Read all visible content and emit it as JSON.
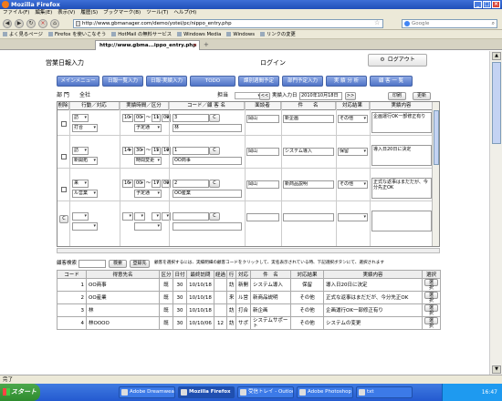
{
  "browser": {
    "title": "Mozilla Firefox",
    "menu": [
      "ファイル(F)",
      "編集(E)",
      "表示(V)",
      "履歴(S)",
      "ブックマーク(B)",
      "ツール(T)",
      "ヘルプ(H)"
    ],
    "url": "http://www.gbmanager.com/demo/yotei/pc/nippo_entry.php",
    "search_placeholder": "Google",
    "bookmarks": [
      "よく見るページ",
      "Firefox を使いこなそう",
      "HotMail の無料サービス",
      "Windows Media",
      "Windows",
      "リンクの変更"
    ],
    "tab_title": "http://www.gbma...ippo_entry.php",
    "status": "完了"
  },
  "header": {
    "system_title": "営業日報入力",
    "login_label": "ログイン",
    "logout_label": "ログアウト"
  },
  "nav": [
    "メインメニュー",
    "日報一覧入力",
    "日報-実績入力",
    "TODO",
    "課別週間予定",
    "部門予定入力",
    "実 績 分 析",
    "顧 客 一 覧"
  ],
  "filter": {
    "dept_label": "部 門",
    "dept_value": "全社",
    "person_label": "担当",
    "prev": "<<",
    "date_label": "実績入力日",
    "date_value": "2010年10月18日",
    "next": ">>",
    "print": "印刷",
    "update": "更新"
  },
  "form_headers": [
    "削除",
    "行動／対応",
    "実績時間／区分",
    "コード／顧 客 名",
    "面談者",
    "件　　名",
    "対応結果",
    "実績内容"
  ],
  "form_rows": [
    {
      "action1": "訪",
      "action2": "打合",
      "t1": "10",
      "m1": "00",
      "t2": "11",
      "m2": "00",
      "kubun": "予定通",
      "code": "3",
      "cust": "林",
      "person": "岡山",
      "subject": "新企画",
      "result": "その他",
      "content": "企画運行OK一部修正有り"
    },
    {
      "action1": "訪",
      "action2": "新開拓",
      "t1": "14",
      "m1": "30",
      "t2": "15",
      "m2": "10",
      "kubun": "時間変更",
      "code": "1",
      "cust": "OO商事",
      "person": "岡山",
      "subject": "システム導入",
      "result": "保留",
      "content": "導入日20日に決定"
    },
    {
      "action1": "来",
      "action2": "ル営業",
      "t1": "16",
      "m1": "00",
      "t2": "17",
      "m2": "00",
      "kubun": "予定通",
      "code": "2",
      "cust": "OO産業",
      "person": "岡山",
      "subject": "新商品説明",
      "result": "その他",
      "content": "正式な返事はまだだが、今分先正OK"
    },
    {
      "action1": "",
      "action2": "",
      "t1": "",
      "m1": "",
      "t2": "",
      "m2": "",
      "kubun": "",
      "code": "",
      "cust": "",
      "person": "",
      "subject": "",
      "result": "",
      "content": ""
    }
  ],
  "customer_search": {
    "label": "顧客検索",
    "search_btn": "検索",
    "register_btn": "登録先",
    "hint": "顧客を選択するには、実績明細の顧客コードをクリックして、実名表示されている時、下記選択ボタンにて、選択されます"
  },
  "grid": {
    "headers": [
      "コード",
      "得意先名",
      "区分",
      "日付",
      "最終訪問",
      "経過",
      "行",
      "対応",
      "件　名",
      "対応結果",
      "実績内容",
      "選択"
    ],
    "rows": [
      {
        "code": "1",
        "name": "OO商事",
        "kubun": "既",
        "n": "30",
        "date": "10/10/18",
        "keika": "",
        "gyo": "訪",
        "taio": "新開",
        "subject": "システム導入",
        "result": "保留",
        "content": "導入日20日に決定",
        "sel": "選択"
      },
      {
        "code": "2",
        "name": "OO産業",
        "kubun": "既",
        "n": "30",
        "date": "10/10/18",
        "keika": "",
        "gyo": "来",
        "taio": "ル営",
        "subject": "新商品説明",
        "result": "その他",
        "content": "正式な返事はまだだが、今分先正OK",
        "sel": "選択"
      },
      {
        "code": "3",
        "name": "林",
        "kubun": "既",
        "n": "30",
        "date": "10/10/18",
        "keika": "",
        "gyo": "訪",
        "taio": "打合",
        "subject": "新企画",
        "result": "その他",
        "content": "企画運行OK一部修正有り",
        "sel": "選択"
      },
      {
        "code": "4",
        "name": "林OOOO",
        "kubun": "既",
        "n": "30",
        "date": "10/10/06",
        "keika": "12",
        "gyo": "訪",
        "taio": "サポ",
        "subject": "システムサポート",
        "result": "その他",
        "content": "システムの変更",
        "sel": "選択"
      }
    ]
  },
  "taskbar": {
    "start": "スタート",
    "items": [
      "Adobe Dreamweaver...",
      "Mozilla Firefox",
      "受信トレイ - Outloo...",
      "Adobe Photoshop ...",
      "txt"
    ],
    "active_index": 1,
    "clock": "16:47"
  }
}
